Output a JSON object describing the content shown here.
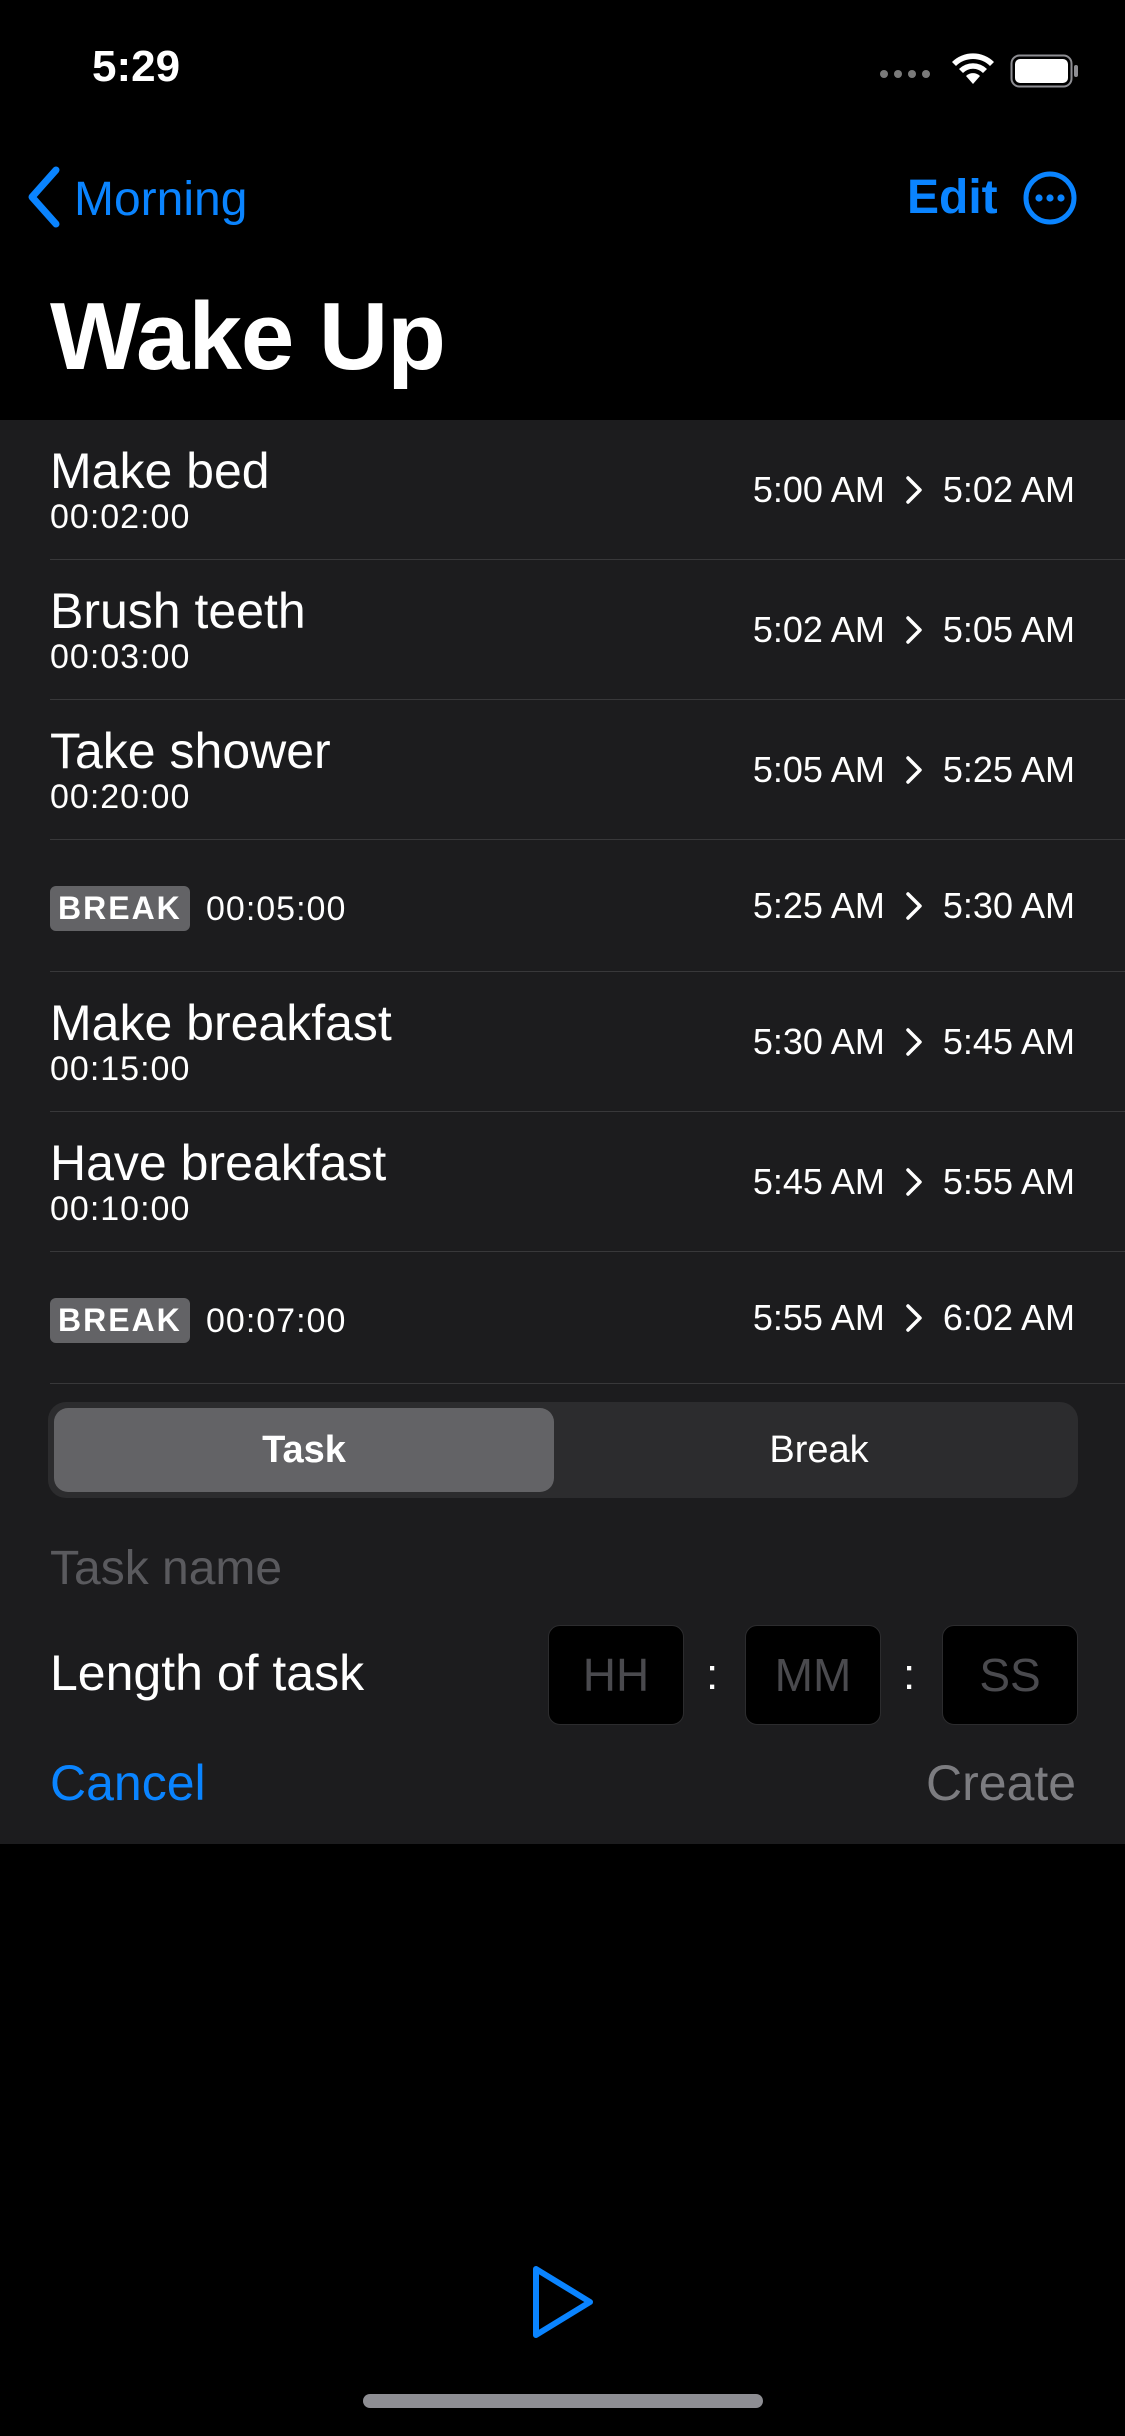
{
  "status_bar": {
    "time": "5:29"
  },
  "nav": {
    "back_label": "Morning",
    "edit_label": "Edit"
  },
  "page_title": "Wake Up",
  "items": [
    {
      "type": "task",
      "name": "Make bed",
      "duration": "00:02:00",
      "start": "5:00 AM",
      "end": "5:02 AM"
    },
    {
      "type": "task",
      "name": "Brush teeth",
      "duration": "00:03:00",
      "start": "5:02 AM",
      "end": "5:05 AM"
    },
    {
      "type": "task",
      "name": "Take shower",
      "duration": "00:20:00",
      "start": "5:05 AM",
      "end": "5:25 AM"
    },
    {
      "type": "break",
      "badge": "BREAK",
      "duration": "00:05:00",
      "start": "5:25 AM",
      "end": "5:30 AM"
    },
    {
      "type": "task",
      "name": "Make breakfast",
      "duration": "00:15:00",
      "start": "5:30 AM",
      "end": "5:45 AM"
    },
    {
      "type": "task",
      "name": "Have breakfast",
      "duration": "00:10:00",
      "start": "5:45 AM",
      "end": "5:55 AM"
    },
    {
      "type": "break",
      "badge": "BREAK",
      "duration": "00:07:00",
      "start": "5:55 AM",
      "end": "6:02 AM"
    }
  ],
  "form": {
    "segments": {
      "task": "Task",
      "break": "Break"
    },
    "selected_segment": "Task",
    "task_name_placeholder": "Task name",
    "length_label": "Length of task",
    "hours_placeholder": "HH",
    "minutes_placeholder": "MM",
    "seconds_placeholder": "SS",
    "separator": ":",
    "cancel_label": "Cancel",
    "create_label": "Create"
  },
  "icons": {
    "back": "chevron-left-icon",
    "more": "ellipsis-circle-icon",
    "arrow": "chevron-right-icon",
    "play": "play-icon",
    "wifi": "wifi-icon",
    "battery": "battery-icon",
    "signal": "cellular-signal-icon"
  },
  "colors": {
    "accent": "#0a84ff",
    "background": "#000000",
    "panel": "#1c1c1e",
    "separator": "#38383a",
    "badge": "#636366",
    "disabled": "#7c7c80"
  }
}
